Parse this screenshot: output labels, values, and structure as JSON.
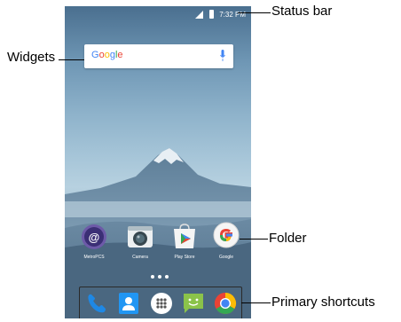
{
  "callouts": {
    "status_bar": "Status bar",
    "widgets": "Widgets",
    "folder": "Folder",
    "primary_shortcuts": "Primary shortcuts"
  },
  "status_bar": {
    "time": "7:32 PM",
    "icons": [
      "signal-icon",
      "battery-icon"
    ]
  },
  "search_widget": {
    "logo": "Google",
    "icons": [
      "mic-icon"
    ]
  },
  "home_apps": [
    {
      "label": "MetroPCS",
      "icon": "metropcs-icon"
    },
    {
      "label": "Camera",
      "icon": "camera-icon"
    },
    {
      "label": "Play Store",
      "icon": "play-store-icon"
    },
    {
      "label": "Google",
      "icon": "google-folder-icon"
    }
  ],
  "page_indicator": {
    "count": 3
  },
  "dock_apps": [
    {
      "icon": "phone-icon"
    },
    {
      "icon": "contacts-icon"
    },
    {
      "icon": "app-drawer-icon"
    },
    {
      "icon": "messaging-icon"
    },
    {
      "icon": "chrome-icon"
    }
  ],
  "colors": {
    "google_blue": "#4285F4",
    "google_red": "#EA4335",
    "google_yellow": "#FBBC05",
    "google_green": "#34A853",
    "messaging_green": "#8BC34A",
    "contacts_blue": "#2196F3"
  }
}
